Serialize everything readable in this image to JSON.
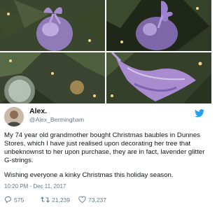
{
  "author": {
    "name": "Alex.",
    "handle": "@Alex_Bermingham"
  },
  "tweet": {
    "paragraph1": "My 74 year old grandmother bought Christmas baubles in Dunnes Stores, which I have just realised upon decorating her tree that unbeknownst to her upon purchase, they are in fact, lavender glitter G-strings.",
    "paragraph2": "Wishing everyone a kinky Christmas this holiday season.",
    "timestamp": "10:20 PM - Dec 11, 2017"
  },
  "stats": {
    "replies": "575",
    "retweets": "21,239",
    "likes": "73,237"
  },
  "colors": {
    "twitter_blue": "#1da1f2",
    "lavender": "#a98bd0",
    "pine": "#2f3b22"
  },
  "icons": [
    "twitter-bird-icon",
    "reply-icon",
    "retweet-icon",
    "like-icon"
  ]
}
